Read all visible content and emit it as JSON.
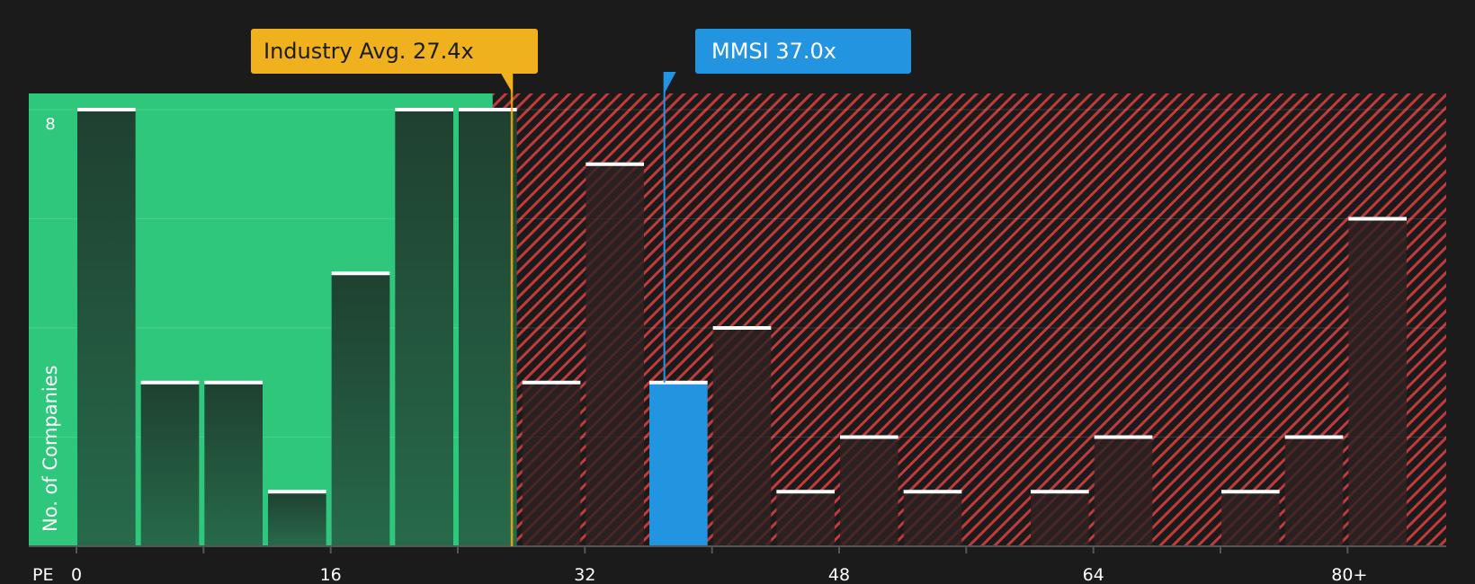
{
  "chart_data": {
    "type": "bar",
    "title": "",
    "xlabel": "PE",
    "ylabel": "No. of Companies",
    "x_tick_labels": [
      "0",
      "16",
      "32",
      "48",
      "64",
      "80+"
    ],
    "y_tick_labels": [
      "8"
    ],
    "ylim": [
      0,
      8
    ],
    "bin_width": 4,
    "bins": [
      {
        "x_start": 0,
        "count": 8
      },
      {
        "x_start": 4,
        "count": 3
      },
      {
        "x_start": 8,
        "count": 3
      },
      {
        "x_start": 12,
        "count": 1
      },
      {
        "x_start": 16,
        "count": 5
      },
      {
        "x_start": 20,
        "count": 8
      },
      {
        "x_start": 24,
        "count": 8
      },
      {
        "x_start": 28,
        "count": 3
      },
      {
        "x_start": 32,
        "count": 7
      },
      {
        "x_start": 36,
        "count": 3,
        "highlight": true
      },
      {
        "x_start": 40,
        "count": 4
      },
      {
        "x_start": 44,
        "count": 1
      },
      {
        "x_start": 48,
        "count": 2
      },
      {
        "x_start": 52,
        "count": 1
      },
      {
        "x_start": 56,
        "count": 0
      },
      {
        "x_start": 60,
        "count": 1
      },
      {
        "x_start": 64,
        "count": 2
      },
      {
        "x_start": 68,
        "count": 0
      },
      {
        "x_start": 72,
        "count": 1
      },
      {
        "x_start": 76,
        "count": 2
      },
      {
        "x_start": 80,
        "count": 6
      }
    ],
    "industry_avg": {
      "label": "Industry Avg. 27.4x",
      "value": 27.4
    },
    "company": {
      "label": "MMSI 37.0x",
      "value": 37.0
    },
    "fair_range_end": 26.2,
    "grid": true,
    "colors": {
      "background": "#1b1b1b",
      "undervalued_zone": "#2ec77c",
      "overvalued_hatch": "#c43a3a",
      "bar_green_zone": "#214d38",
      "bar_red_zone": "#2e2222",
      "highlight_bar": "#2394e0",
      "industry_line": "#efb11d",
      "company_line": "#2394e0",
      "bar_cap": "#ffffff",
      "axis_text": "#ffffff"
    }
  }
}
